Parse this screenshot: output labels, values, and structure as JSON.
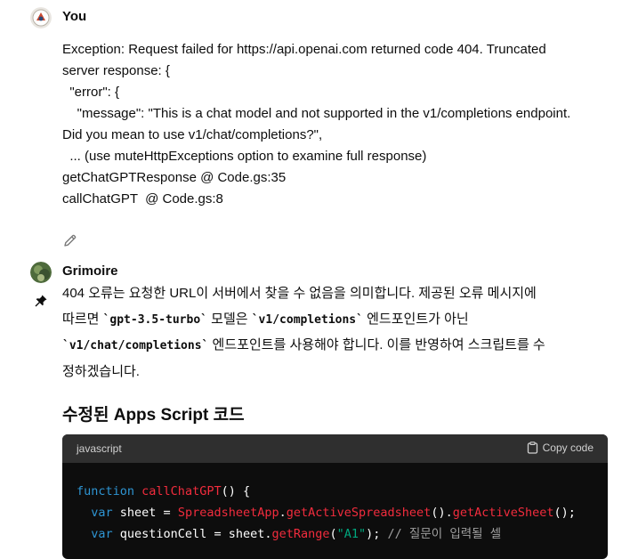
{
  "user": {
    "name": "You",
    "lines": [
      "Exception: Request failed for https://api.openai.com returned code 404. Truncated",
      "server response: {",
      "  \"error\": {",
      "    \"message\": \"This is a chat model and not supported in the v1/completions endpoint.",
      "Did you mean to use v1/chat/completions?\",",
      "  ... (use muteHttpExceptions option to examine full response)",
      "getChatGPTResponse @ Code.gs:35",
      "callChatGPT  @ Code.gs:8"
    ]
  },
  "assistant": {
    "name": "Grimoire",
    "p1": "404 오류는 요청한 URL이 서버에서 찾을 수 없음을 의미합니다. 제공된 오류 메시지에",
    "p2_pre": "따르면 ",
    "p2_code1": "`gpt-3.5-turbo`",
    "p2_mid": " 모델은 ",
    "p2_code2": "`v1/completions`",
    "p2_post": " 엔드포인트가 아닌",
    "p3_code": "`v1/chat/completions`",
    "p3_post": " 엔드포인트를 사용해야 합니다. 이를 반영하여 스크립트를 수",
    "p4": "정하겠습니다.",
    "heading": "수정된 Apps Script 코드",
    "code_language": "javascript",
    "copy_label": "Copy code",
    "code": {
      "l1_kw": "function",
      "l1_fn": "callChatGPT",
      "l1_rest": "() {",
      "l2_kw": "var",
      "l2_a": " sheet = ",
      "l2_fn1": "SpreadsheetApp",
      "l2_dot1": ".",
      "l2_fn2": "getActiveSpreadsheet",
      "l2_dot2": "().",
      "l2_fn3": "getActiveSheet",
      "l2_end": "();",
      "l3_kw": "var",
      "l3_a": " questionCell = sheet.",
      "l3_fn": "getRange",
      "l3_p1": "(",
      "l3_str": "\"A1\"",
      "l3_p2": "); ",
      "l3_cm": "// 질문이 입력될 셀"
    }
  }
}
